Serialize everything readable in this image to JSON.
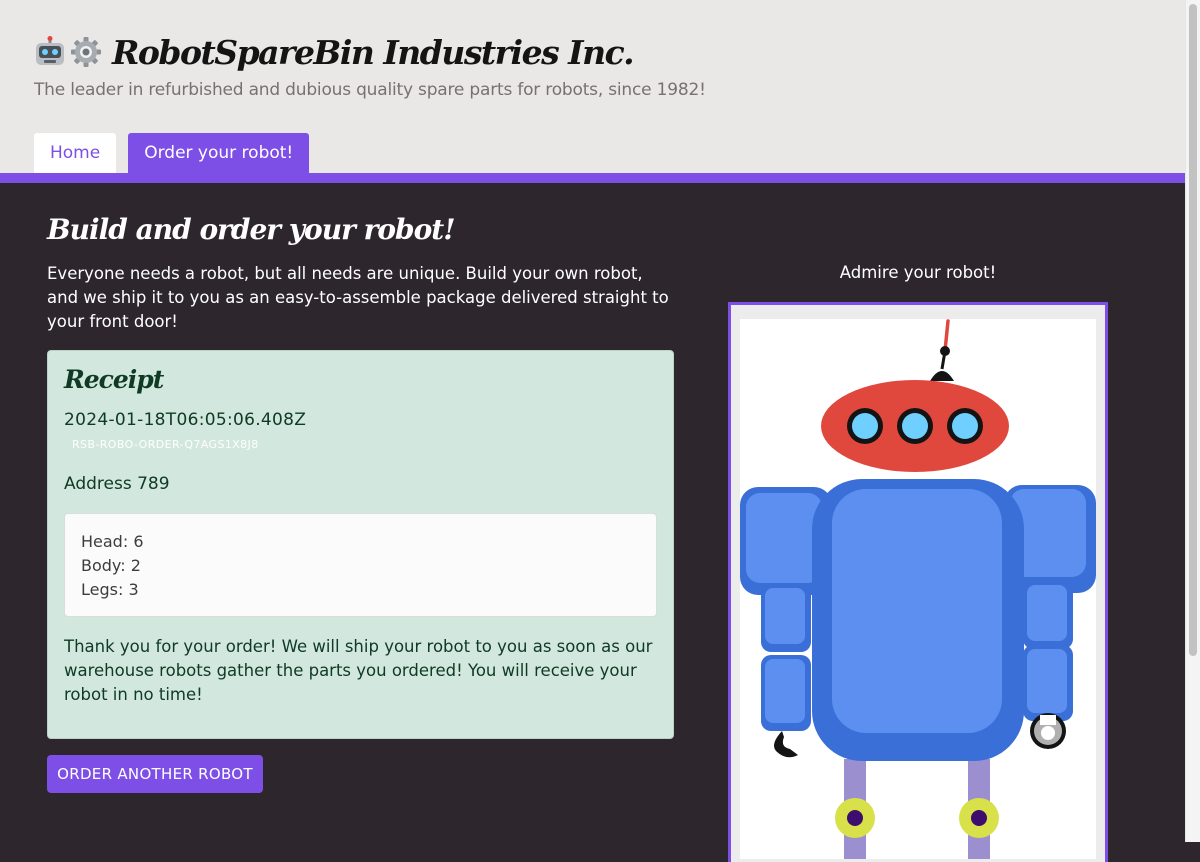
{
  "header": {
    "title": "RobotSpareBin Industries Inc.",
    "tagline": "The leader in refurbished and dubious quality spare parts for robots, since 1982!"
  },
  "nav": {
    "tabs": [
      {
        "label": "Home",
        "active": false
      },
      {
        "label": "Order your robot!",
        "active": true
      }
    ]
  },
  "main": {
    "title": "Build and order your robot!",
    "intro": "Everyone needs a robot, but all needs are unique. Build your own robot, and we ship it to you as an easy-to-assemble package delivered straight to your front door!",
    "order_another_label": "ORDER ANOTHER ROBOT"
  },
  "receipt": {
    "title": "Receipt",
    "timestamp": "2024-01-18T06:05:06.408Z",
    "order_id": "RSB-ROBO-ORDER-Q7AGS1X8J8",
    "address": "Address 789",
    "parts": {
      "head": "Head: 6",
      "body": "Body: 2",
      "legs": "Legs: 3"
    },
    "thanks": "Thank you for your order! We will ship your robot to you as soon as our warehouse robots gather the parts you ordered! You will receive your robot in no time!"
  },
  "preview": {
    "label": "Admire your robot!"
  },
  "colors": {
    "accent": "#7e4fe6",
    "page_background": "#2e262d",
    "header_background": "#e9e8e6",
    "receipt_background": "#d2e7dd",
    "robot_head": "#e0483e",
    "robot_body": "#3a6fd8",
    "robot_legs": "#9b8fcf",
    "robot_feet": "#d8e04a"
  }
}
